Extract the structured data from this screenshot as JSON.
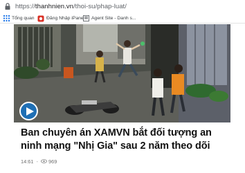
{
  "browser": {
    "url_scheme": "https://",
    "url_host": "thanhnien.vn",
    "url_path": "/thoi-su/phap-luat/",
    "lock_icon": "padlock-icon"
  },
  "bookmarks": [
    {
      "label": "Tổng quan",
      "icon": "grid-apps-icon",
      "color": "#1a73e8"
    },
    {
      "label": "Đăng Nhập iPanel",
      "icon": "ipanel-logo-icon",
      "color": "#d93025"
    },
    {
      "label": "Agent Site - Danh s...",
      "icon": "agent-site-icon",
      "color": "#5f6368"
    }
  ],
  "video": {
    "play_icon": "play-icon",
    "play_button_color": "#1f6fb4"
  },
  "article": {
    "title": "Ban chuyên án XAMVN bắt đối tượng an ninh mạng \"Nhị Gia\" sau 2 năm theo dõi",
    "time": "14:61",
    "views": "969",
    "views_icon": "eye-icon"
  }
}
